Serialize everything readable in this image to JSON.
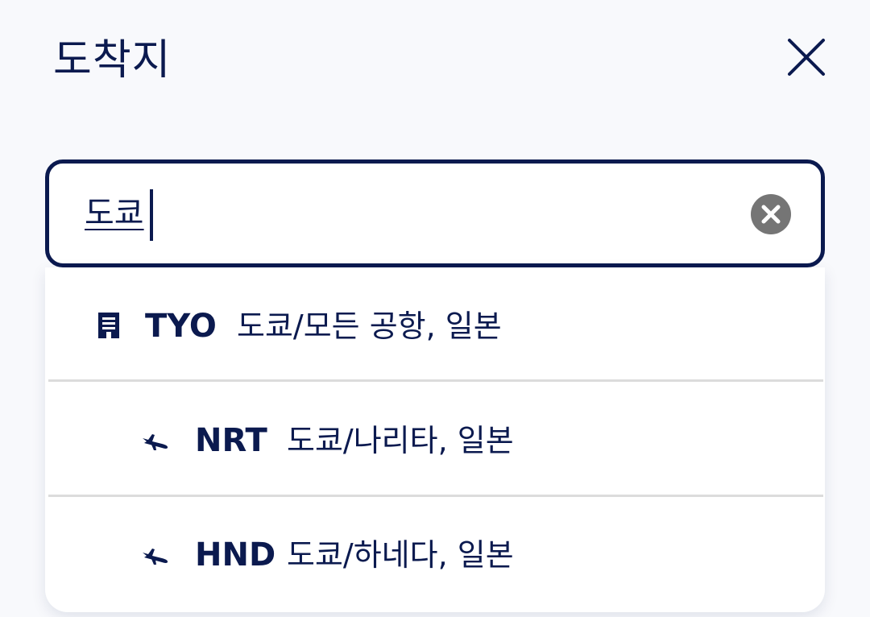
{
  "header": {
    "title": "도착지",
    "close_icon": "close-icon"
  },
  "search": {
    "value": "도쿄",
    "clear_icon": "clear-circle-icon"
  },
  "results": [
    {
      "icon": "city-building-icon",
      "code": "TYO",
      "description": "도쿄/모든 공항, 일본"
    },
    {
      "icon": "plane-arrival-icon",
      "code": "NRT",
      "description": "도쿄/나리타, 일본"
    },
    {
      "icon": "plane-arrival-icon",
      "code": "HND",
      "description": "도쿄/하네다, 일본"
    }
  ],
  "colors": {
    "text": "#0b1a4f",
    "background": "#f8f9fc",
    "clear_button": "#757575",
    "divider": "#dcdcdc"
  }
}
